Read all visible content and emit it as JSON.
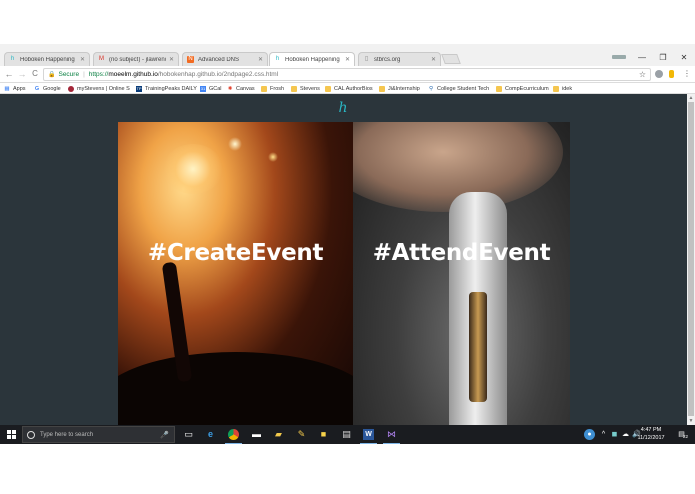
{
  "window": {
    "minimize": "—",
    "restore": "❐",
    "close": "✕"
  },
  "tabs": [
    {
      "title": "Hoboken Happening",
      "icon": "h-icon",
      "active": false
    },
    {
      "title": "(no subject) - jlawrenc@",
      "icon": "gmail-icon",
      "active": false
    },
    {
      "title": "Advanced DNS",
      "icon": "nc-icon",
      "active": false
    },
    {
      "title": "Hoboken Happening",
      "icon": "h-icon",
      "active": true
    },
    {
      "title": "stbrcs.org",
      "icon": "page-icon",
      "active": false
    }
  ],
  "toolbar": {
    "back": "←",
    "forward": "→",
    "reload": "C",
    "secure_label": "Secure",
    "url_scheme": "https://",
    "url_host": "moeelm.github.io",
    "url_path": "/hobokenhap.github.io/2ndpage2.css.html",
    "star": "☆"
  },
  "bookmarks": [
    {
      "label": "Apps",
      "icon": "apps-grid-icon"
    },
    {
      "label": "Google",
      "icon": "google-icon"
    },
    {
      "label": "myStevens | Online S",
      "icon": "stevens-icon"
    },
    {
      "label": "TrainingPeaks DAILY",
      "icon": "trainingpeaks-icon"
    },
    {
      "label": "GCal",
      "icon": "gcal-icon"
    },
    {
      "label": "Canvas",
      "icon": "canvas-icon"
    },
    {
      "label": "Frosh",
      "icon": "folder-icon"
    },
    {
      "label": "Stevens",
      "icon": "folder-icon"
    },
    {
      "label": "CAL AuthorBios",
      "icon": "folder-icon"
    },
    {
      "label": "Ji&Internship",
      "icon": "folder-icon"
    },
    {
      "label": "College Student Tech",
      "icon": "college-icon"
    },
    {
      "label": "CompEcurriculum",
      "icon": "folder-icon"
    },
    {
      "label": "idek",
      "icon": "folder-icon"
    }
  ],
  "page": {
    "logo": "h",
    "panels": [
      {
        "heading": "#CreateEvent"
      },
      {
        "heading": "#AttendEvent"
      }
    ]
  },
  "taskbar": {
    "search_placeholder": "Type here to search",
    "clock_time": "4:47 PM",
    "clock_date": "11/12/2017",
    "notification_count": "22"
  },
  "colors": {
    "page_bg": "#2b353b",
    "logo": "#2ab7c4",
    "secure_green": "#0b8043",
    "taskbar_bg": "#1a1c20"
  }
}
